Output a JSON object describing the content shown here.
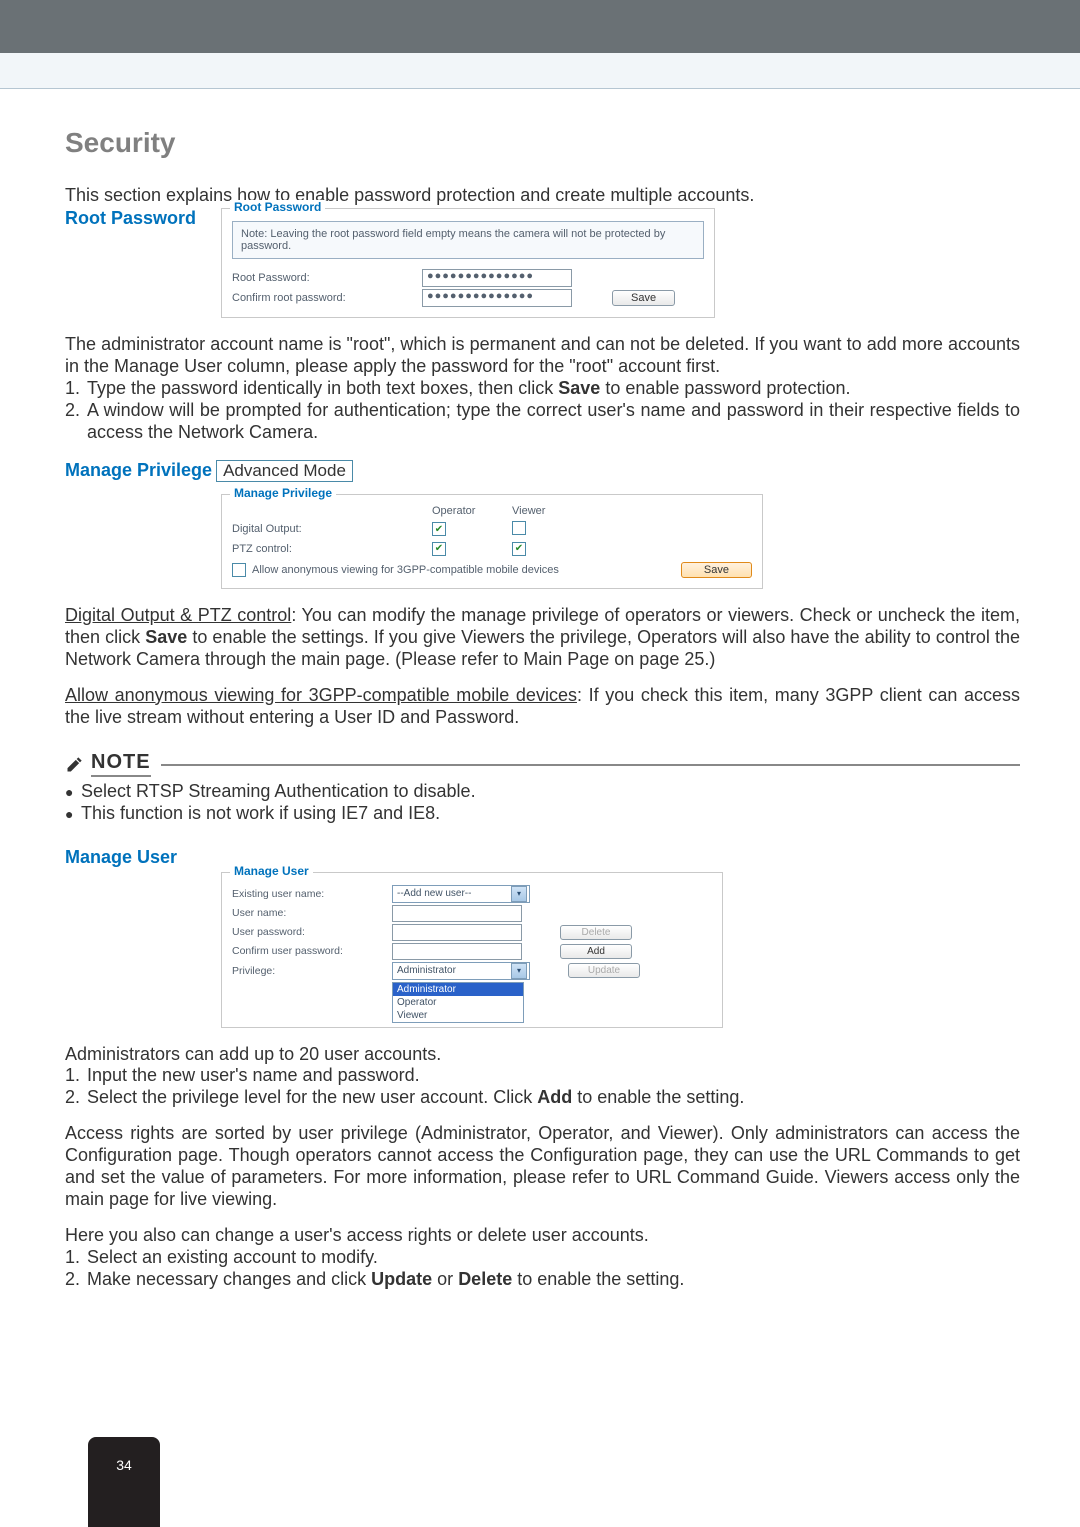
{
  "page_number": "34",
  "title": "Security",
  "intro": "This section explains how to enable password protection and create multiple accounts.",
  "root_password": {
    "heading": "Root Password",
    "legend": "Root Password",
    "note": "Note: Leaving the root password field empty means the camera will not be protected by password.",
    "row1_label": "Root Password:",
    "row2_label": "Confirm root password:",
    "masked": "●●●●●●●●●●●●●●",
    "save": "Save"
  },
  "root_desc": {
    "p1a": "The administrator account name is \"root\", which is permanent and can not be deleted. If you want to add more accounts in the Manage User column, please apply the password for the \"root\" account first.",
    "li1a": "Type the password identically in both text boxes, then click ",
    "li1b": "Save",
    "li1c": " to enable password protection.",
    "li2": "A window will be prompted for authentication; type the correct user's name and password in their respective fields to access the Network Camera."
  },
  "manage_privilege": {
    "heading": "Manage Privilege",
    "badge": "Advanced Mode",
    "legend": "Manage Privilege",
    "col_operator": "Operator",
    "col_viewer": "Viewer",
    "row_digital": "Digital Output:",
    "row_ptz": "PTZ control:",
    "allow_anon": "Allow anonymous viewing for 3GPP-compatible mobile devices",
    "save": "Save"
  },
  "mp_desc": {
    "d1_u": "Digital Output & PTZ control",
    "d1a": ": You can modify the manage privilege of operators or viewers. Check or uncheck the item, then click ",
    "d1b": "Save",
    "d1c": " to enable the settings. If you give Viewers the privilege, Operators will also have the ability to control the Network Camera through the main page. (Please refer to Main Page on page 25.)",
    "d2_u": "Allow anonymous viewing for 3GPP-compatible mobile devices",
    "d2a": ": If you check this item, many 3GPP client can access the live stream without entering a User ID and Password."
  },
  "note": {
    "word": "NOTE",
    "b1": "Select RTSP Streaming Authentication to disable.",
    "b2": "This function is not work if using IE7 and IE8."
  },
  "manage_user": {
    "heading": "Manage User",
    "legend": "Manage User",
    "existing": "Existing user name:",
    "existing_val": "--Add new user--",
    "uname": "User name:",
    "upwd": "User password:",
    "cpwd": "Confirm user password:",
    "priv": "Privilege:",
    "priv_val": "Administrator",
    "delete": "Delete",
    "add": "Add",
    "update": "Update",
    "opts": {
      "o1": "Administrator",
      "o2": "Operator",
      "o3": "Viewer"
    }
  },
  "mu_desc": {
    "p1": "Administrators can add up to 20 user accounts.",
    "li1": "Input the new user's name and password.",
    "li2a": "Select the privilege level for the new user account. Click ",
    "li2b": "Add",
    "li2c": " to enable the setting.",
    "p2": "Access rights are sorted by user privilege (Administrator, Operator, and Viewer). Only administrators can access the Configuration page. Though operators cannot access the Configuration page, they can use the URL Commands to get and set the value of parameters. For more information, please refer to URL Command Guide. Viewers access only the main page for live viewing.",
    "p3": "Here you also can change a user's access rights or delete user accounts.",
    "li3": "Select an existing account to modify.",
    "li4a": "Make necessary changes and click ",
    "li4b": "Update",
    "li4c": " or ",
    "li4d": "Delete",
    "li4e": " to enable the setting."
  }
}
